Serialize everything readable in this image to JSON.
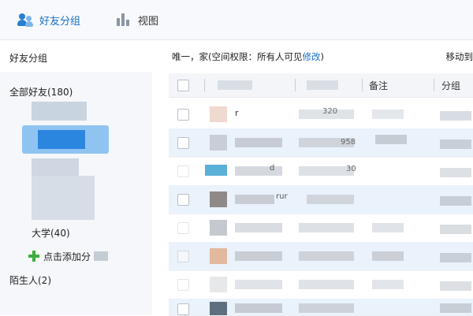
{
  "toolbar": {
    "tabs": [
      {
        "label": "好友分组",
        "icon": "friends-icon",
        "active": true
      },
      {
        "label": "视图",
        "icon": "bar-chart-icon",
        "active": false
      }
    ]
  },
  "sidebar": {
    "title": "好友分组",
    "groups": [
      {
        "label": "全部好友(180)"
      },
      {
        "label": "大学(40)"
      },
      {
        "label": "点击添加分"
      },
      {
        "label": "陌生人(2)"
      }
    ]
  },
  "main": {
    "group_info": "唯一，家(空间权限：所有人可见",
    "edit_link": "修改",
    "group_info_close": ")",
    "move_to": "移动到",
    "columns": [
      "备注",
      "分组"
    ],
    "partial_cells": [
      "r",
      "320",
      "958",
      "30",
      "rur",
      "d"
    ],
    "rows_visible": 8
  },
  "colors": {
    "accent": "#1a6fc9",
    "row_highlight": "#eaf2fc",
    "add_icon": "#3cae3c"
  }
}
